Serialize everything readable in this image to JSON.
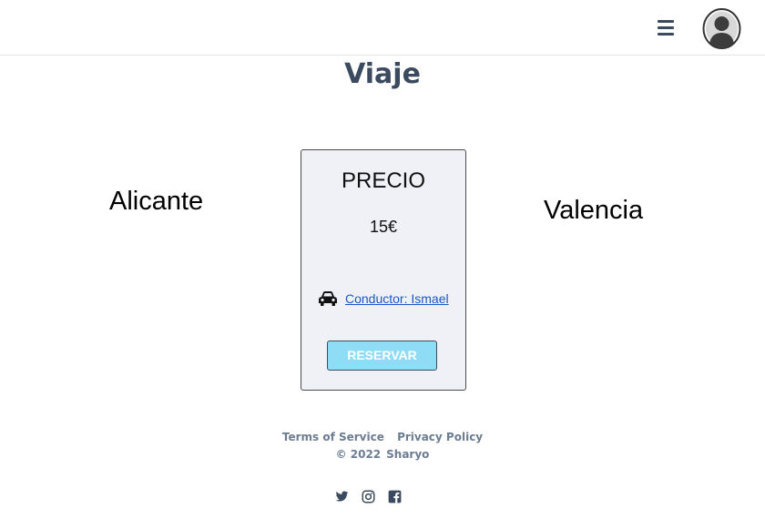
{
  "header": {
    "menu_icon": "hamburger-menu-icon",
    "avatar_icon": "user-avatar-icon"
  },
  "page": {
    "title": "Viaje"
  },
  "trip": {
    "origin": "Alicante",
    "destination": "Valencia"
  },
  "card": {
    "title": "PRECIO",
    "price": "15€",
    "driver_icon": "car-icon",
    "driver_label": "Conductor: Ismael",
    "reserve_label": "RESERVAR"
  },
  "footer": {
    "terms": "Terms of Service",
    "privacy": "Privacy Policy",
    "copyright": "© 2022",
    "brand": "Sharyo",
    "social": [
      "twitter-icon",
      "instagram-icon",
      "facebook-icon"
    ]
  },
  "colors": {
    "title": "#3b4a5e",
    "card_bg": "#eff1f6",
    "button_bg": "#8fdcf7",
    "link": "#1a56c8",
    "footer_text": "#6b7c93"
  }
}
